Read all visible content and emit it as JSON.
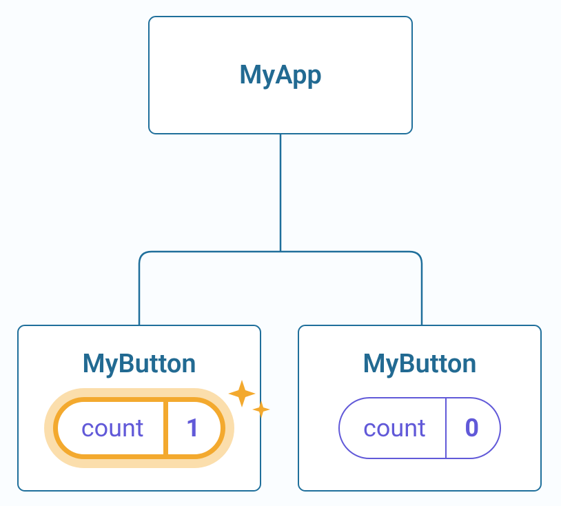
{
  "root": {
    "title": "MyApp"
  },
  "children": [
    {
      "title": "MyButton",
      "highlighted": true,
      "state": {
        "label": "count",
        "value": "1"
      }
    },
    {
      "title": "MyButton",
      "highlighted": false,
      "state": {
        "label": "count",
        "value": "0"
      }
    }
  ]
}
